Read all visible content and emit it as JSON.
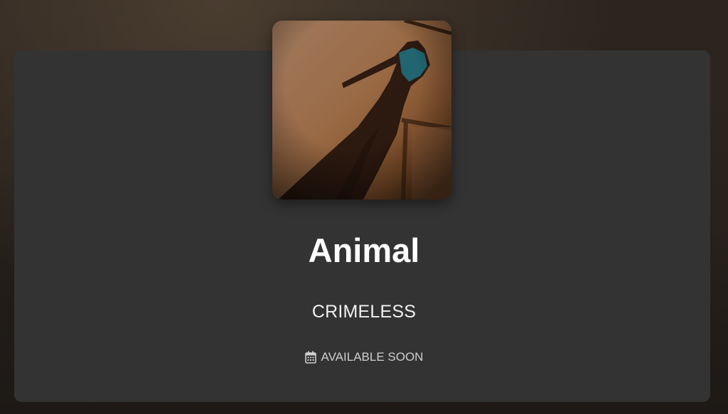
{
  "release": {
    "title": "Animal",
    "artist": "CRIMELESS",
    "status_label": "AVAILABLE SOON",
    "status_icon": "calendar-icon",
    "cover_art": "shadow-of-person-on-pavement"
  },
  "colors": {
    "card_background": "#333333",
    "title_text": "#ffffff",
    "status_text": "#cfcfcf"
  }
}
